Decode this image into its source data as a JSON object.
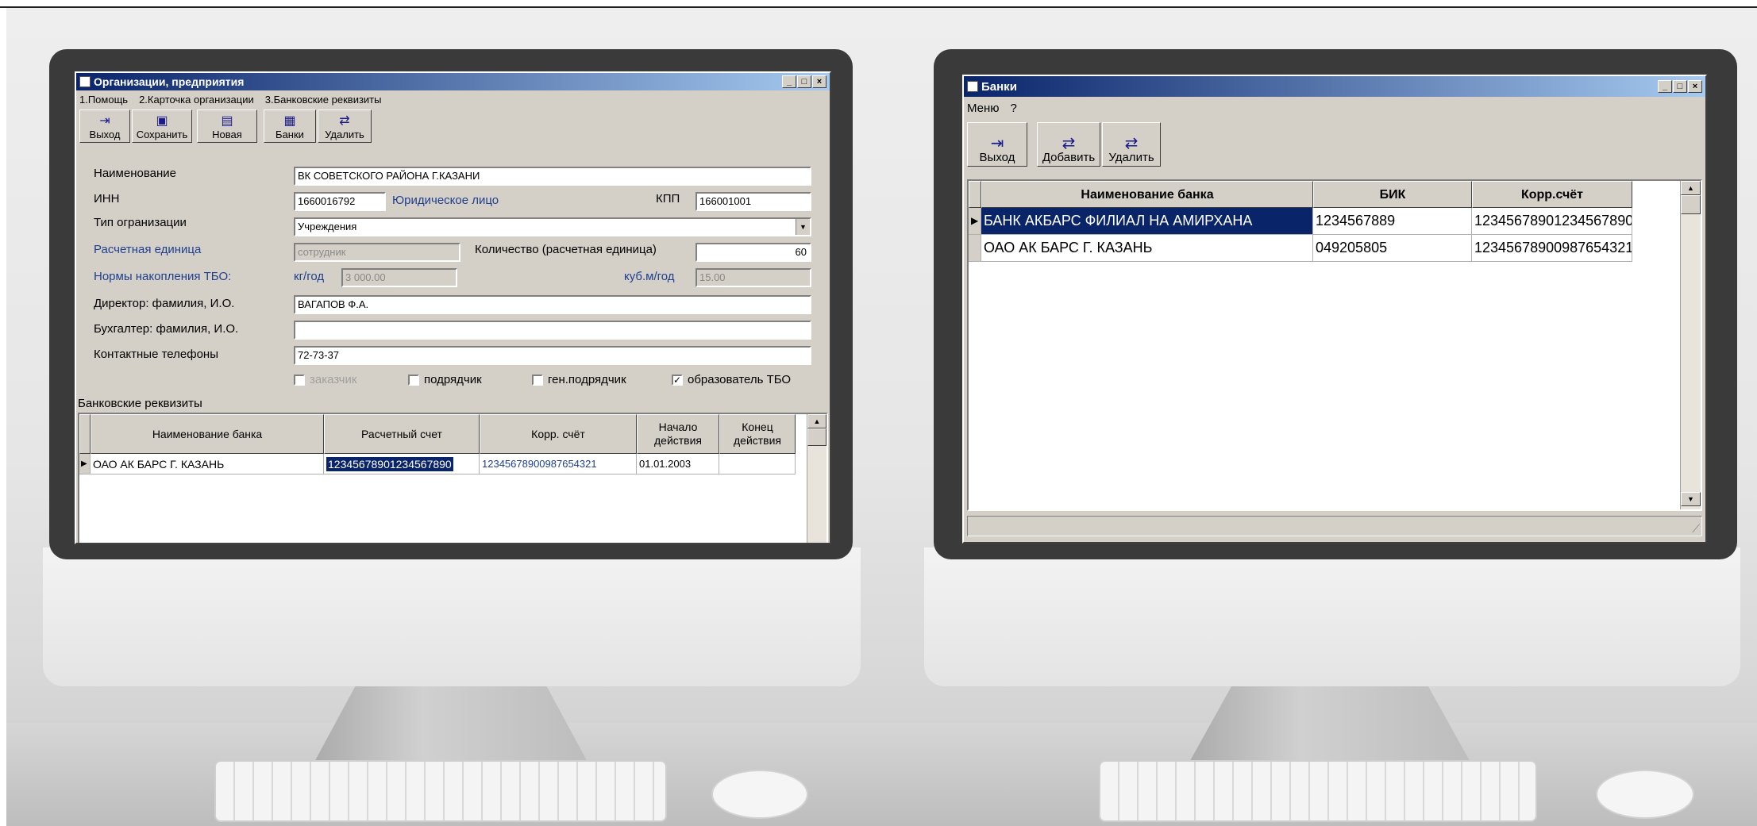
{
  "left_window": {
    "title": "Организации, предприятия",
    "menu": [
      "1.Помощь",
      "2.Карточка организации",
      "3.Банковские реквизиты"
    ],
    "toolbar": [
      "Выход",
      "Сохранить",
      "Новая",
      "Банки",
      "Удалить"
    ],
    "form": {
      "name_label": "Наименование",
      "name_value": "ВК СОВЕТСКОГО РАЙОНА Г.КАЗАНИ",
      "inn_label": "ИНН",
      "inn_value": "1660016792",
      "legal_entity": "Юридическое лицо",
      "kpp_label": "КПП",
      "kpp_value": "166001001",
      "org_type_label": "Тип огранизации",
      "org_type_value": "Учреждения",
      "calc_unit_label": "Расчетная единица",
      "calc_unit_value": "сотрудник",
      "qty_label": "Количество (расчетная единица)",
      "qty_value": "60",
      "norms_label": "Нормы накопления ТБО:",
      "kg_label": "кг/год",
      "kg_value": "3 000.00",
      "m3_label": "куб.м/год",
      "m3_value": "15.00",
      "director_label": "Директор: фамилия, И.О.",
      "director_value": "ВАГАПОВ Ф.А.",
      "accountant_label": "Бухгалтер: фамилия, И.О.",
      "accountant_value": "",
      "phones_label": "Контактные телефоны",
      "phones_value": "72-73-37",
      "checkboxes": [
        {
          "label": "заказчик",
          "checked": false,
          "disabled": true
        },
        {
          "label": "подрядчик",
          "checked": false,
          "disabled": false
        },
        {
          "label": "ген.подрядчик",
          "checked": false,
          "disabled": false
        },
        {
          "label": "образователь ТБО",
          "checked": true,
          "disabled": false
        }
      ]
    },
    "bank_section": {
      "title": "Банковские реквизиты",
      "headers": [
        "Наименование банка",
        "Расчетный счет",
        "Корр. счёт",
        "Начало действия",
        "Конец действия"
      ],
      "rows": [
        [
          "ОАО АК БАРС Г. КАЗАНЬ",
          "12345678901234567890",
          "12345678900987654321",
          "01.01.2003",
          ""
        ]
      ]
    }
  },
  "right_window": {
    "title": "Банки",
    "menu": [
      "Меню",
      "?"
    ],
    "toolbar": [
      "Выход",
      "Добавить",
      "Удалить"
    ],
    "headers": [
      "Наименование банка",
      "БИК",
      "Корр.счёт"
    ],
    "rows": [
      [
        "БАНК АКБАРС ФИЛИАЛ НА АМИРХАНА",
        "1234567889",
        "12345678901234567890"
      ],
      [
        "ОАО АК БАРС Г. КАЗАНЬ",
        "049205805",
        "12345678900987654321"
      ]
    ]
  },
  "icons": {
    "exit": "exit-door-icon",
    "save": "floppy-disk-icon",
    "new": "new-document-icon",
    "banks": "bank-icon",
    "delete": "delete-icon",
    "add": "add-icon"
  },
  "colors": {
    "title_gradient_start": "#0a246a",
    "title_gradient_end": "#a6caf0",
    "window_face": "#d4d0c8",
    "selection": "#0a246a",
    "label_blue": "#1f3f8f"
  }
}
